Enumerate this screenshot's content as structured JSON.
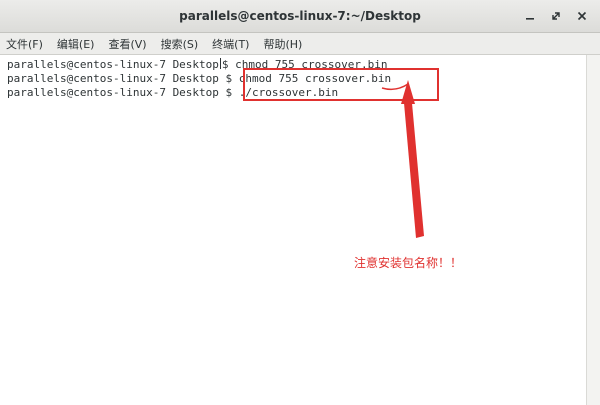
{
  "window": {
    "title": "parallels@centos-linux-7:~/Desktop"
  },
  "menubar": {
    "items": [
      {
        "label": "文件(F)"
      },
      {
        "label": "编辑(E)"
      },
      {
        "label": "查看(V)"
      },
      {
        "label": "搜索(S)"
      },
      {
        "label": "终端(T)"
      },
      {
        "label": "帮助(H)"
      }
    ]
  },
  "terminal": {
    "prompt": "parallels@centos-linux-7 Desktop",
    "lines": [
      {
        "command": "$ chmod 755 crossover.bin"
      },
      {
        "command": "$ chmod 755 crossover.bin"
      },
      {
        "command": "$ ./crossover.bin"
      }
    ]
  },
  "annotation": {
    "note": "注意安装包名称！！",
    "color": "#e0312f"
  },
  "icons": {
    "minimize": "minimize-icon",
    "maximize": "maximize-icon",
    "close": "close-icon"
  }
}
